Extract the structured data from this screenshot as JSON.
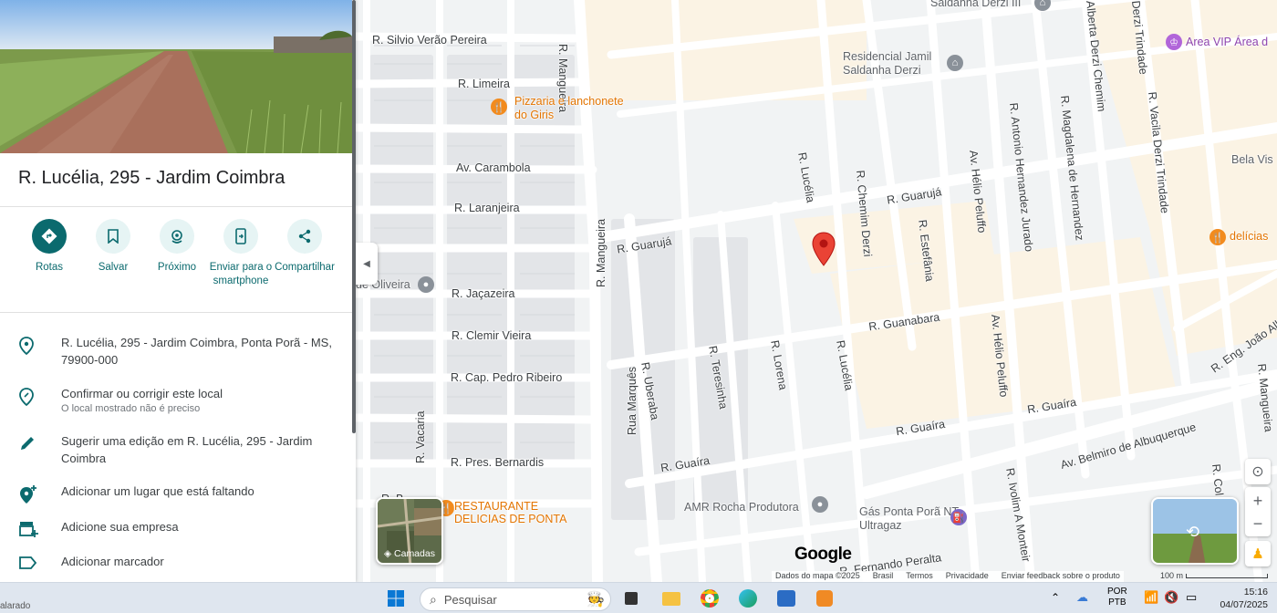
{
  "panel": {
    "title": "R. Lucélia, 295 - Jardim Coimbra",
    "actions": [
      {
        "label": "Rotas",
        "icon": "directions-icon"
      },
      {
        "label": "Salvar",
        "icon": "bookmark-icon"
      },
      {
        "label": "Próximo",
        "icon": "nearby-icon"
      },
      {
        "label": "Enviar para o smartphone",
        "icon": "send-to-phone-icon"
      },
      {
        "label": "Compartilhar",
        "icon": "share-icon"
      }
    ],
    "address": "R. Lucélia, 295 - Jardim Coimbra, Ponta Porã - MS, 79900-000",
    "confirm": {
      "title": "Confirmar ou corrigir este local",
      "sub": "O local mostrado não é preciso"
    },
    "suggest_edit": "Sugerir uma edição em R. Lucélia, 295 - Jardim Coimbra",
    "add_place": "Adicionar um lugar que está faltando",
    "add_business": "Adicione sua empresa",
    "add_label": "Adicionar marcador"
  },
  "map": {
    "streets": [
      "R. Silvio Verão Pereira",
      "R. Limeira",
      "Av. Carambola",
      "R. Laranjeira",
      "R. Jaçazeira",
      "R. Clemir Vieira",
      "R. Cap. Pedro Ribeiro",
      "R. Pres. Bernardis",
      "R. Vacaria",
      "R. Mangueira",
      "R. Mangueira",
      "Rua Marquês",
      "R. Uberaba",
      "R. Teresinha",
      "R. Lorena",
      "R. Lucélia",
      "R. Lucélia",
      "R. Guarujá",
      "R. Guarujá",
      "R. Chemim Derzi",
      "R. Estefânia",
      "Av. Hélio Peluffo",
      "Av. Hélio Peluffo",
      "R. Antonio Hernandez Jurado",
      "R. Magdalena de Hernandez",
      "R. Guanabara",
      "R. Guaíra",
      "R. Guaíra",
      "R. Guaíra",
      "Av. Belmiro de Albuquerque",
      "R. Ivolim A Monteir",
      "R. Fernando Peralta",
      "Alberta Derzi Chemim",
      "Derzi Trindade",
      "R. Vacila Derzi Trindade",
      "R. Eng. João Albe",
      "R. Col",
      "R. Mangueira",
      "R. B"
    ],
    "places": {
      "residencial_iii": "Saldanha Derzi III",
      "residencial_jamil": "Residencial Jamil Saldanha Derzi",
      "pizzaria": "Pizzaria e lanchonete do Giris",
      "area_vip": "Area VIP Área d",
      "bela_vista": "Bela Vis",
      "delicias": "delícias",
      "oliveira": "de Oliveira",
      "restaurante": "RESTAURANTE DELICIAS DE PONTA",
      "amr": "AMR Rocha Produtora",
      "gas": "Gás Ponta Porã NT Ultragaz"
    },
    "layers_label": "Camadas",
    "google_logo": "Google",
    "footer": [
      "Dados do mapa ©2025",
      "Brasil",
      "Termos",
      "Privacidade",
      "Enviar feedback sobre o produto"
    ],
    "scale": "100 m",
    "colors": {
      "accent": "#0b6a6e",
      "pin": "#ea4335",
      "poi": "#e37400"
    }
  },
  "taskbar": {
    "search_placeholder": "Pesquisar",
    "left_text": "alarado",
    "lang": "POR",
    "lang2": "PTB",
    "time": "15:16",
    "date": "04/07/2025"
  }
}
